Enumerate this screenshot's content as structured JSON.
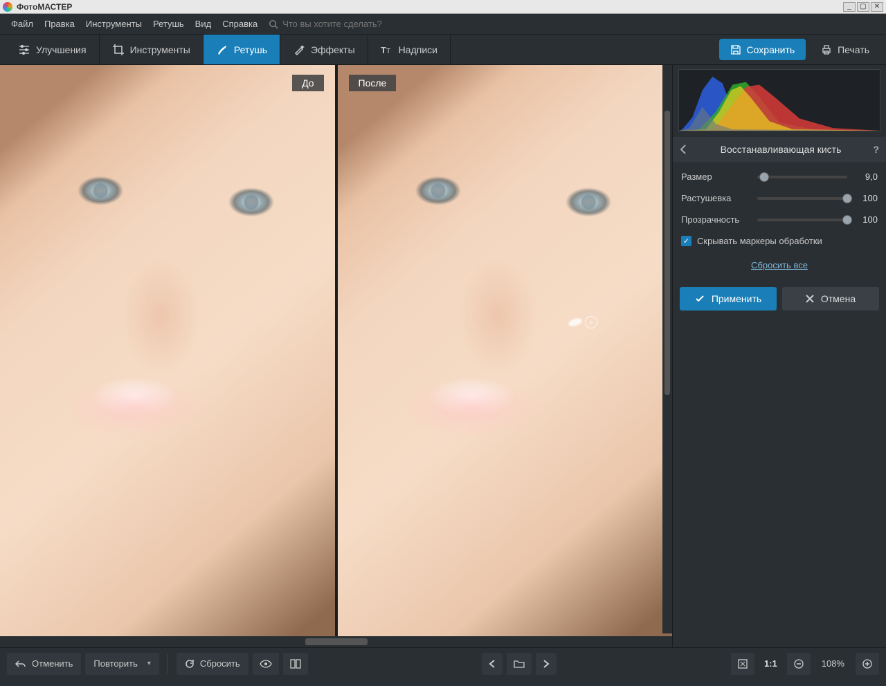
{
  "app": {
    "title": "ФотоМАСТЕР"
  },
  "menu": {
    "items": [
      "Файл",
      "Правка",
      "Инструменты",
      "Ретушь",
      "Вид",
      "Справка"
    ],
    "search_placeholder": "Что вы хотите сделать?"
  },
  "toolbar": {
    "tabs": [
      {
        "label": "Улучшения",
        "icon": "sliders"
      },
      {
        "label": "Инструменты",
        "icon": "crop"
      },
      {
        "label": "Ретушь",
        "icon": "brush",
        "active": true
      },
      {
        "label": "Эффекты",
        "icon": "sparkle"
      },
      {
        "label": "Надписи",
        "icon": "text"
      }
    ],
    "save_label": "Сохранить",
    "print_label": "Печать"
  },
  "canvas": {
    "before_label": "До",
    "after_label": "После"
  },
  "panel": {
    "title": "Восстанавливающая кисть",
    "controls": {
      "size": {
        "label": "Размер",
        "value": "9,0",
        "pos": 8
      },
      "feather": {
        "label": "Растушевка",
        "value": "100",
        "pos": 100
      },
      "opacity": {
        "label": "Прозрачность",
        "value": "100",
        "pos": 100
      }
    },
    "hide_markers_label": "Скрывать маркеры обработки",
    "reset_label": "Сбросить все",
    "apply_label": "Применить",
    "cancel_label": "Отмена"
  },
  "bottombar": {
    "undo_label": "Отменить",
    "redo_label": "Повторить",
    "reset_label": "Сбросить",
    "zoom_ratio": "1:1",
    "zoom_value": "108%"
  }
}
